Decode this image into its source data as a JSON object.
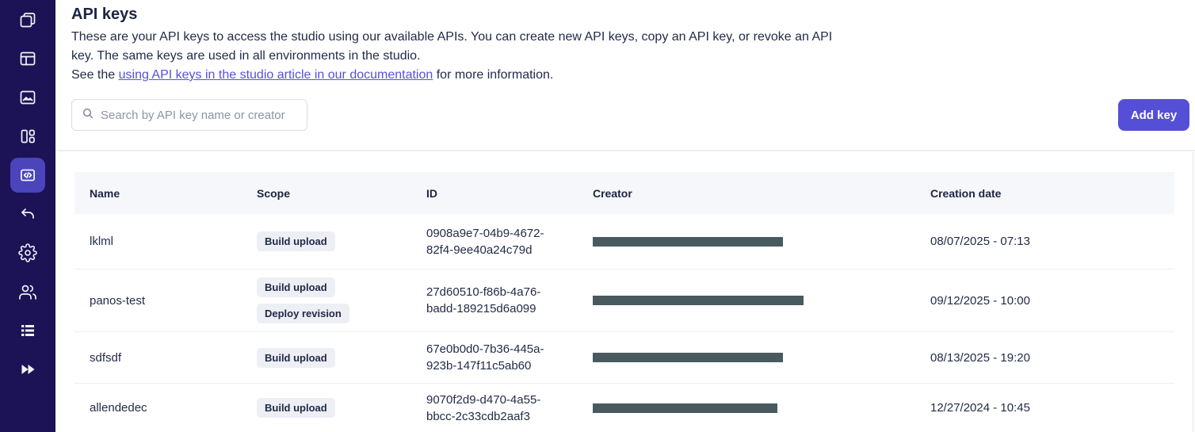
{
  "sidebar": {
    "items": [
      {
        "icon": "layers-icon",
        "active": false
      },
      {
        "icon": "browser-layout-icon",
        "active": false
      },
      {
        "icon": "image-icon",
        "active": false
      },
      {
        "icon": "dashboard-icon",
        "active": false
      },
      {
        "icon": "code-icon",
        "active": true
      },
      {
        "icon": "undo-arrow-icon",
        "active": false
      },
      {
        "icon": "settings-gear-icon",
        "active": false
      },
      {
        "icon": "users-icon",
        "active": false
      },
      {
        "icon": "list-icon",
        "active": false
      },
      {
        "icon": "fast-forward-icon",
        "active": false
      }
    ]
  },
  "header": {
    "title": "API keys",
    "description": "These are your API keys to access the studio using our available APIs. You can create new API keys, copy an API key, or revoke an API key. The same keys are used in all environments in the studio.",
    "see_prefix": "See the ",
    "link_text": "using API keys in the studio article in our documentation",
    "see_suffix": " for more information."
  },
  "toolbar": {
    "search_placeholder": "Search by API key name or creator",
    "add_key_label": "Add key"
  },
  "table": {
    "columns": [
      "Name",
      "Scope",
      "ID",
      "Creator",
      "Creation date"
    ],
    "rows": [
      {
        "name": "lklml",
        "scopes": [
          "Build upload"
        ],
        "id_line1": "0908a9e7-04b9-4672-",
        "id_line2": "82f4-9ee40a24c79d",
        "creator_redacted": true,
        "creator_bar_width": 240,
        "creation_date": "08/07/2025 - 07:13"
      },
      {
        "name": "panos-test",
        "scopes": [
          "Build upload",
          "Deploy revision"
        ],
        "id_line1": "27d60510-f86b-4a76-",
        "id_line2": "badd-189215d6a099",
        "creator_redacted": true,
        "creator_bar_width": 266,
        "creation_date": "09/12/2025 - 10:00"
      },
      {
        "name": "sdfsdf",
        "scopes": [
          "Build upload"
        ],
        "id_line1": "67e0b0d0-7b36-445a-",
        "id_line2": "923b-147f11c5ab60",
        "creator_redacted": true,
        "creator_bar_width": 240,
        "creation_date": "08/13/2025 - 19:20"
      },
      {
        "name": "allendedec",
        "scopes": [
          "Build upload"
        ],
        "id_line1": "9070f2d9-d470-4a55-",
        "id_line2": "bbcc-2c33cdb2aaf3",
        "creator_redacted": true,
        "creator_bar_width": 233,
        "creation_date": "12/27/2024 - 10:45"
      }
    ]
  },
  "colors": {
    "sidebar_bg": "#1b1356",
    "active_item_bg": "#4b44ba",
    "primary_button": "#554fd8",
    "link": "#564fe0",
    "text": "#222b45",
    "badge_bg": "#edeff5",
    "table_header_bg": "#f5f7fb",
    "redaction_bar": "#485a5e"
  }
}
